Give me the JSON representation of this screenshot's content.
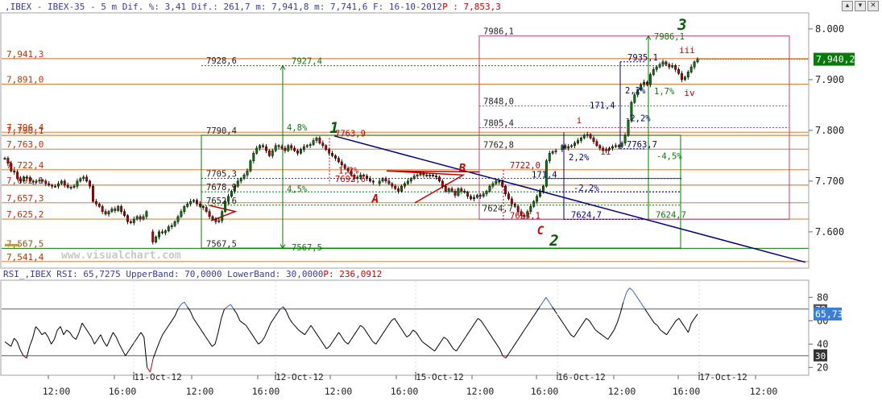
{
  "price_header": {
    "prefix": ",IBEX - IBEX-35 - 5 m Dif. %: 3,41 Dif.: 261,7 m: 7,941,8 m: 7,741,6 F: 16-10-2012",
    "p_label": "P : 7,853,3"
  },
  "rsi_header": {
    "prefix": "RSI_,IBEX RSI: 65,7275 UpperBand: 70,0000 LowerBand: 30,0000",
    "p_label": "P: 236,0912"
  },
  "watermark": "www.visualchart.com",
  "window_buttons": [
    "▴",
    "▾",
    "✕"
  ],
  "colors": {
    "candle_up": "#0a7a0a",
    "candle_down": "#c00000",
    "trend_line": "#000080",
    "fib_orange": "#d2691e",
    "green_box": "#0a7a0a",
    "magenta_box": "#c0407a",
    "rsi_line": "#000000",
    "rsi_overbought": "#3060d0",
    "rsi_oversold": "#c00000"
  },
  "chart_data": [
    {
      "type": "candlestick",
      "title": "IBEX - IBEX-35 - 5 m",
      "ylim": [
        7530,
        8030
      ],
      "y_ticks": [
        "8.000",
        "7.900",
        "7.800",
        "7.700",
        "7.600"
      ],
      "y_tick_values": [
        8000,
        7900,
        7800,
        7700,
        7600
      ],
      "current_price": "7,940,2",
      "current_value": 7940.2,
      "x": {
        "ticks": [
          "12:00",
          "16:00",
          "12:00",
          "16:00",
          "12:00",
          "16:00",
          "12:00",
          "16:00",
          "12:00",
          "16:00",
          "12:00"
        ],
        "dates": [
          "11-Oct-12",
          "12-Oct-12",
          "15-Oct-12",
          "16-Oct-12",
          "17-Oct-12"
        ]
      },
      "series": [
        {
          "close_path": [
            7745,
            7735,
            7720,
            7718,
            7705,
            7700,
            7708,
            7706,
            7700,
            7698,
            7700,
            7702,
            7700,
            7695,
            7692,
            7690,
            7690,
            7695,
            7700,
            7692,
            7688,
            7688,
            7690,
            7700,
            7705,
            7708,
            7700,
            7690,
            7660,
            7655,
            7650,
            7640,
            7635,
            7640,
            7645,
            7642,
            7650,
            7640,
            7632,
            7620,
            7618,
            7625,
            7630,
            7625,
            7630,
            7640,
            7600,
            7580,
            7590,
            7600,
            7598,
            7602,
            7610,
            7612,
            7620,
            7630,
            7640,
            7650,
            7655,
            7660,
            7662,
            7655,
            7650,
            7648,
            7640,
            7630,
            7625,
            7620,
            7622,
            7640,
            7660,
            7670,
            7680,
            7690,
            7700,
            7705,
            7712,
            7720,
            7740,
            7755,
            7765,
            7770,
            7768,
            7760,
            7750,
            7760,
            7770,
            7768,
            7765,
            7760,
            7770,
            7765,
            7760,
            7755,
            7762,
            7768,
            7770,
            7772,
            7780,
            7785,
            7775,
            7770,
            7762,
            7755,
            7750,
            7745,
            7738,
            7732,
            7725,
            7720,
            7712,
            7705,
            7708,
            7712,
            7710,
            7705,
            7700,
            7698,
            7695,
            7700,
            7705,
            7700,
            7695,
            7690,
            7685,
            7680,
            7690,
            7695,
            7700,
            7705,
            7710,
            7712,
            7715,
            7712,
            7710,
            7712,
            7710,
            7708,
            7700,
            7690,
            7680,
            7685,
            7680,
            7672,
            7685,
            7680,
            7678,
            7670,
            7665,
            7668,
            7672,
            7670,
            7675,
            7680,
            7690,
            7695,
            7700,
            7698,
            7690,
            7675,
            7665,
            7655,
            7650,
            7640,
            7632,
            7630,
            7640,
            7650,
            7660,
            7670,
            7680,
            7690,
            7740,
            7755,
            7758,
            7760,
            7762,
            7770,
            7765,
            7768,
            7770,
            7775,
            7780,
            7785,
            7790,
            7792,
            7785,
            7778,
            7770,
            7765,
            7760,
            7762,
            7765,
            7768,
            7770,
            7768,
            7775,
            7790,
            7820,
            7855,
            7870,
            7880,
            7890,
            7895,
            7890,
            7910,
            7920,
            7925,
            7930,
            7935,
            7930,
            7925,
            7928,
            7920,
            7912,
            7900,
            7905,
            7915,
            7925,
            7935,
            7940
          ]
        }
      ],
      "annotations": {
        "wave_labels": [
          "1",
          "2",
          "3",
          "A",
          "B",
          "C",
          "i",
          "ii",
          "iii",
          "iv"
        ],
        "wave_values": [
          7795,
          7573,
          7998,
          7658,
          7718,
          7595,
          7814,
          7752,
          7952,
          7868
        ],
        "left_levels": [
          {
            "label": "7,941,3",
            "value": 7941.3
          },
          {
            "label": "7,891,0",
            "value": 7891.0
          },
          {
            "label": "7,796,4",
            "value": 7796.4
          },
          {
            "label": "7,790,1",
            "value": 7790.1
          },
          {
            "label": "7,763,0",
            "value": 7763.0
          },
          {
            "label": "7,722,4",
            "value": 7722.4
          },
          {
            "label": "7,692,1",
            "value": 7692.1
          },
          {
            "label": "7,657,3",
            "value": 7657.3
          },
          {
            "label": "7,625,2",
            "value": 7625.2
          },
          {
            "label": "7,567,5",
            "value": 7567.5
          },
          {
            "label": "7,541,4",
            "value": 7541.4
          }
        ],
        "level_labels": [
          {
            "label": "7928,6",
            "value": 7928.6
          },
          {
            "label": "7927,4",
            "value": 7927.4
          },
          {
            "label": "7790,4",
            "value": 7790.4
          },
          {
            "label": "4,8%",
            "value": 7797
          },
          {
            "label": "7763,9",
            "value": 7785
          },
          {
            "label": "7705,3",
            "value": 7705.3
          },
          {
            "label": "7678,9",
            "value": 7678.9
          },
          {
            "label": "4,5%",
            "value": 7675
          },
          {
            "label": "7652,6",
            "value": 7652.6
          },
          {
            "label": "7567,5",
            "value": 7567.5
          },
          {
            "label": "7567,5",
            "value": 7560
          },
          {
            "label": "1,2%",
            "value": 7712
          },
          {
            "label": "7692,6",
            "value": 7695
          },
          {
            "label": "7986,1",
            "value": 7986.1
          },
          {
            "label": "7986,1",
            "value": 7976
          },
          {
            "label": "7935,1",
            "value": 7935.1
          },
          {
            "label": "7848,0",
            "value": 7848.0
          },
          {
            "label": "171,4",
            "value": 7840
          },
          {
            "label": "2,2%",
            "value": 7870
          },
          {
            "label": "1,7%",
            "value": 7868
          },
          {
            "label": "7805,4",
            "value": 7805.4
          },
          {
            "label": "-2,2%",
            "value": 7815
          },
          {
            "label": "7762,8",
            "value": 7762.8
          },
          {
            "label": "7763,7",
            "value": 7763.7
          },
          {
            "label": "2,2%",
            "value": 7738
          },
          {
            "label": "-4,5%",
            "value": 7740
          },
          {
            "label": "7722,0",
            "value": 7722.0
          },
          {
            "label": "171,4",
            "value": 7704
          },
          {
            "label": "-2,2%",
            "value": 7678
          },
          {
            "label": "7624,7",
            "value": 7637
          },
          {
            "label": "7623,1",
            "value": 7623.1
          },
          {
            "label": "7624,7",
            "value": 7624.7
          },
          {
            "label": "7624,7",
            "value": 7624.7
          }
        ]
      }
    },
    {
      "type": "line",
      "title": "RSI_,IBEX RSI",
      "ylim": [
        14,
        94
      ],
      "y_ticks": [
        "80",
        "60",
        "40",
        "20"
      ],
      "y_tick_values": [
        80,
        60,
        40,
        20
      ],
      "upper_band": 70,
      "lower_band": 30,
      "band_labels": [
        "70",
        "30"
      ],
      "current_label": "65,73",
      "current_value": 65.73,
      "series": [
        {
          "name": "RSI",
          "values": [
            42,
            40,
            38,
            45,
            42,
            35,
            30,
            28,
            38,
            45,
            55,
            52,
            48,
            50,
            46,
            40,
            44,
            52,
            55,
            48,
            52,
            50,
            46,
            44,
            50,
            58,
            54,
            50,
            46,
            40,
            44,
            48,
            42,
            38,
            44,
            50,
            46,
            40,
            35,
            30,
            34,
            38,
            42,
            46,
            50,
            46,
            20,
            16,
            28,
            35,
            42,
            48,
            52,
            56,
            60,
            64,
            70,
            74,
            76,
            72,
            68,
            62,
            58,
            54,
            50,
            46,
            42,
            38,
            40,
            50,
            62,
            70,
            72,
            74,
            70,
            66,
            60,
            58,
            56,
            52,
            48,
            44,
            40,
            42,
            46,
            52,
            58,
            62,
            66,
            70,
            72,
            68,
            62,
            58,
            55,
            52,
            50,
            48,
            52,
            56,
            52,
            48,
            44,
            40,
            36,
            38,
            42,
            46,
            50,
            46,
            42,
            40,
            44,
            48,
            52,
            56,
            54,
            50,
            46,
            42,
            40,
            44,
            48,
            52,
            56,
            60,
            62,
            58,
            54,
            50,
            46,
            48,
            52,
            50,
            46,
            42,
            40,
            38,
            36,
            34,
            38,
            42,
            46,
            44,
            40,
            36,
            34,
            38,
            42,
            46,
            50,
            54,
            58,
            62,
            60,
            56,
            52,
            48,
            44,
            40,
            36,
            30,
            28,
            32,
            36,
            40,
            44,
            48,
            52,
            56,
            60,
            64,
            68,
            72,
            76,
            80,
            76,
            72,
            68,
            64,
            60,
            56,
            52,
            48,
            46,
            50,
            54,
            58,
            62,
            60,
            56,
            52,
            50,
            48,
            46,
            44,
            48,
            52,
            58,
            66,
            76,
            84,
            88,
            86,
            82,
            78,
            74,
            70,
            66,
            62,
            58,
            56,
            52,
            50,
            48,
            52,
            56,
            60,
            62,
            58,
            54,
            50,
            58,
            62,
            65.7
          ]
        }
      ]
    }
  ]
}
